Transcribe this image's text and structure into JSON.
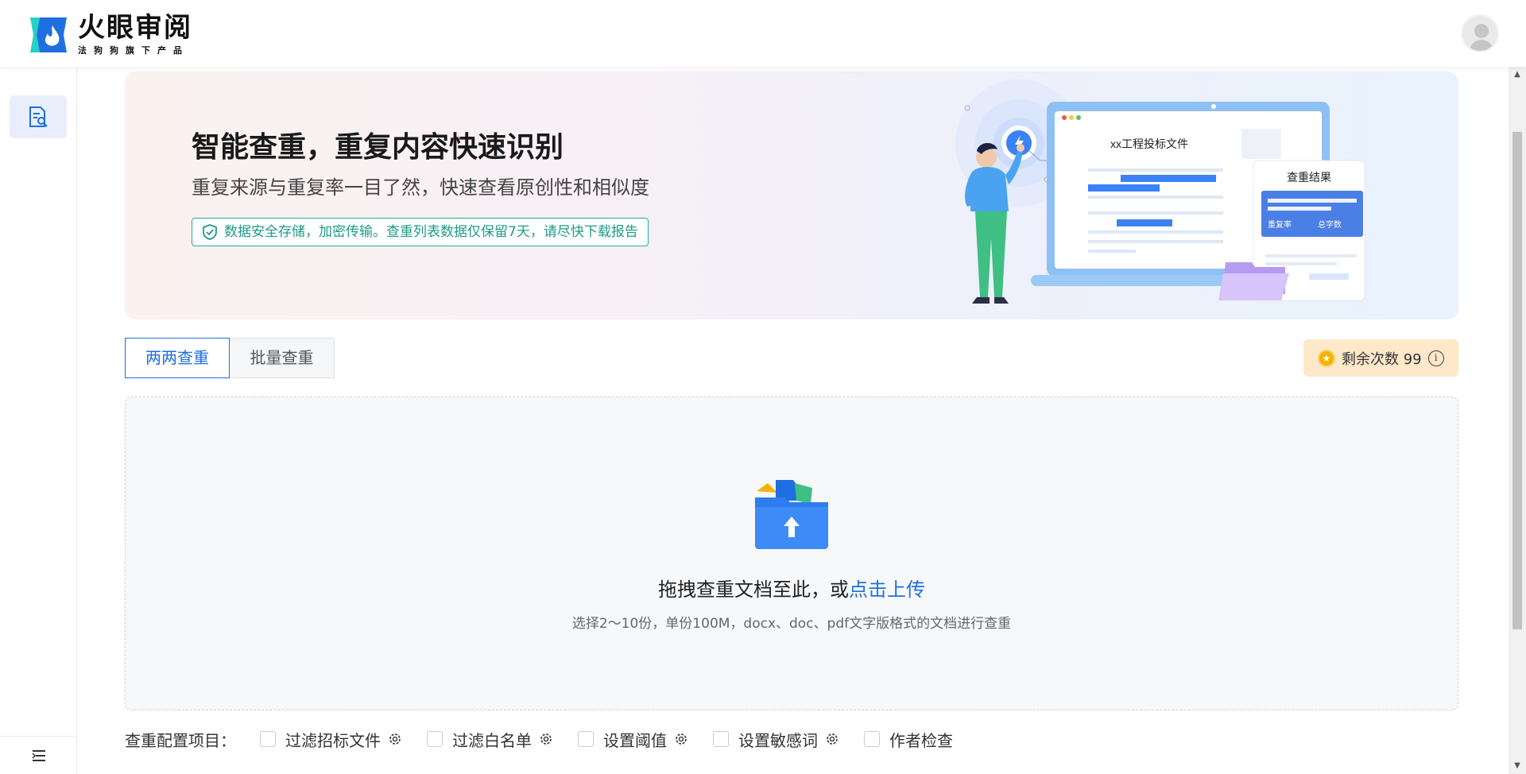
{
  "header": {
    "logo_title": "火眼审阅",
    "logo_sub": "法狗狗旗下产品",
    "avatar": "user-avatar"
  },
  "sidebar": {
    "items": [
      {
        "icon": "document-search-icon",
        "active": true
      }
    ],
    "bottom_icon": "menu-collapse-icon"
  },
  "banner": {
    "title": "智能查重，重复内容快速识别",
    "subtitle": "重复来源与重复率一目了然，快速查看原创性和相似度",
    "note": "数据安全存储，加密传输。查重列表数据仅保留7天，请尽快下载报告",
    "illus": {
      "doc_title": "xx工程投标文件",
      "result_title": "查重结果",
      "result_rate": "重复率",
      "result_count": "总字数"
    }
  },
  "tabs": [
    {
      "label": "两两查重",
      "active": true
    },
    {
      "label": "批量查重",
      "active": false
    }
  ],
  "remaining": {
    "label": "剩余次数 99"
  },
  "upload": {
    "text_prefix": "拖拽查重文档至此，或",
    "link": "点击上传",
    "hint": "选择2～10份，单份100M，docx、doc、pdf文字版格式的文档进行查重"
  },
  "config": {
    "label": "查重配置项目：",
    "options": [
      {
        "label": "过滤招标文件",
        "has_settings": true,
        "checked": false
      },
      {
        "label": "过滤白名单",
        "has_settings": true,
        "checked": false
      },
      {
        "label": "设置阈值",
        "has_settings": true,
        "checked": false
      },
      {
        "label": "设置敏感词",
        "has_settings": true,
        "checked": false
      },
      {
        "label": "作者检查",
        "has_settings": false,
        "checked": false
      }
    ]
  },
  "colors": {
    "primary": "#1f6fe0",
    "accent_green": "#1d9c86",
    "badge_bg": "#fde8c9"
  }
}
